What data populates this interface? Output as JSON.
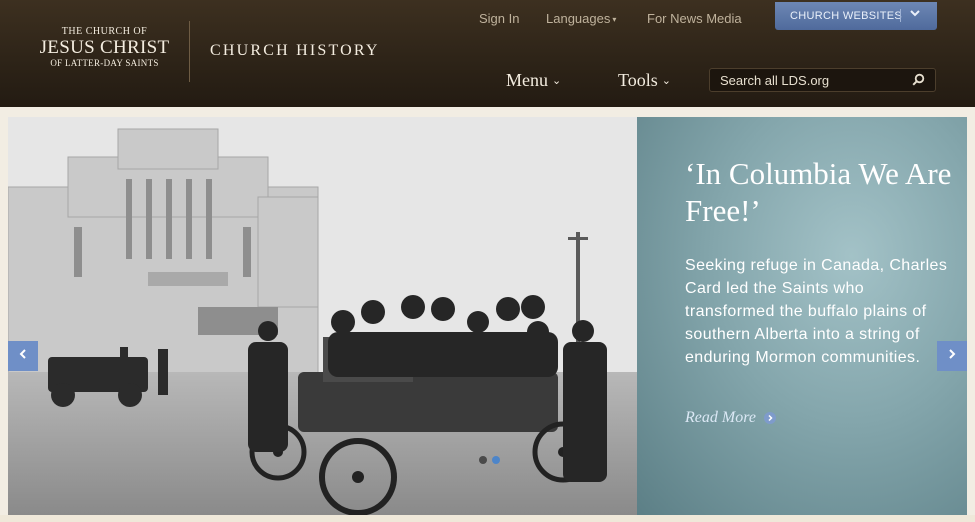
{
  "header": {
    "logo": {
      "line1": "THE CHURCH OF",
      "line2": "JESUS CHRIST",
      "line3": "OF LATTER-DAY SAINTS"
    },
    "site_title": "CHURCH HISTORY",
    "top_links": {
      "sign_in": "Sign In",
      "languages": "Languages",
      "news_media": "For News Media"
    },
    "church_websites": "CHURCH WEBSITES",
    "nav": {
      "menu": "Menu",
      "tools": "Tools"
    },
    "search": {
      "placeholder": "Search all LDS.org",
      "icon": "search-icon"
    }
  },
  "hero": {
    "title": "‘In Columbia We Are Free!’",
    "text": "Seeking refuge in Canada, Charles Card led the Saints who transformed the buffalo plains of southern Alberta into a string of enduring Mormon communities.",
    "read_more": "Read More",
    "prev_icon": "chevron-left-icon",
    "next_icon": "chevron-right-icon",
    "slides": 2,
    "active_slide": 2
  },
  "colors": {
    "header_bg": "#2e2418",
    "accent_blue": "#6f8fc7",
    "panel_teal": "#84a6ac"
  }
}
